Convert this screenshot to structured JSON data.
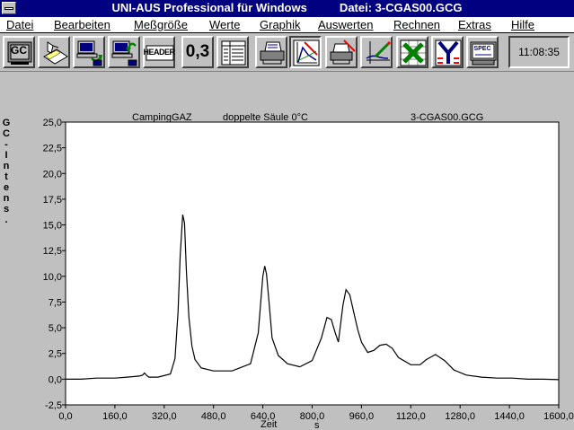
{
  "window": {
    "title": "UNI-AUS Professional für Windows          Datei: 3-CGAS00.GCG"
  },
  "menu": [
    {
      "label": "Datei"
    },
    {
      "label": "Bearbeiten"
    },
    {
      "label": "Meßgröße"
    },
    {
      "label": "Werte"
    },
    {
      "label": "Graphik"
    },
    {
      "label": "Auswerten"
    },
    {
      "label": "Rechnen"
    },
    {
      "label": "Extras"
    },
    {
      "label": "Hilfe"
    }
  ],
  "toolbar": {
    "gc_label": "GC",
    "header_label": "HEADER",
    "number_label": "0,3",
    "spec_label": "SPEC",
    "clock": "11:08:35",
    "icons": [
      "gc-icon",
      "hand-notepad-icon",
      "computer-download-icon",
      "computer-upload-icon",
      "header-icon",
      "value-icon",
      "table-icon",
      "printer-icon",
      "graph-icon",
      "printer-settings-icon",
      "pen-curve-icon",
      "excel-icon",
      "y-axis-icon",
      "spec-monitor-icon"
    ]
  },
  "colors": {
    "title_bar": "#000080",
    "plot_bg": "#ffffff",
    "trace": "#000000",
    "window_bg": "#c0c0c0"
  },
  "chart_data": {
    "type": "line",
    "header": {
      "left": "CampingGAZ",
      "middle": "doppelte Säule 0°C",
      "right": "3-CGAS00.GCG"
    },
    "ylabel": "GC-Intens.",
    "xlabel": "Zeit",
    "xunit": "s",
    "xlim": [
      0,
      1600
    ],
    "ylim": [
      -2.5,
      25
    ],
    "xticks": [
      0,
      160,
      320,
      480,
      640,
      800,
      960,
      1120,
      1280,
      1440,
      1600
    ],
    "xtick_labels": [
      "0,0",
      "160,0",
      "320,0",
      "480,0",
      "640,0",
      "800,0",
      "960,0",
      "1120,0",
      "1280,0",
      "1440,0",
      "1600,0"
    ],
    "yticks": [
      -2.5,
      0,
      2.5,
      5,
      7.5,
      10,
      12.5,
      15,
      17.5,
      20,
      22.5,
      25
    ],
    "ytick_labels": [
      "-2,5",
      "0,0",
      "2,5",
      "5,0",
      "7,5",
      "10,0",
      "12,5",
      "15,0",
      "17,5",
      "20,0",
      "22,5",
      "25,0"
    ],
    "grid": false,
    "series": [
      {
        "x": [
          0,
          50,
          100,
          160,
          200,
          240,
          250,
          256,
          262,
          270,
          300,
          340,
          355,
          365,
          372,
          380,
          386,
          392,
          400,
          410,
          420,
          440,
          480,
          540,
          600,
          625,
          640,
          646,
          652,
          660,
          670,
          690,
          720,
          760,
          800,
          830,
          848,
          862,
          875,
          885,
          900,
          910,
          922,
          935,
          948,
          960,
          980,
          1000,
          1020,
          1040,
          1060,
          1080,
          1120,
          1150,
          1170,
          1200,
          1230,
          1260,
          1300,
          1350,
          1400,
          1450,
          1500,
          1550,
          1600
        ],
        "y": [
          0.0,
          0.0,
          0.1,
          0.1,
          0.2,
          0.3,
          0.4,
          0.6,
          0.4,
          0.2,
          0.2,
          0.5,
          2.0,
          6.5,
          12.0,
          16.0,
          15.2,
          10.5,
          6.0,
          3.2,
          1.9,
          1.1,
          0.8,
          0.8,
          1.5,
          4.5,
          10.0,
          11.0,
          10.2,
          7.5,
          4.0,
          2.3,
          1.5,
          1.2,
          1.8,
          4.0,
          6.0,
          5.8,
          4.5,
          3.6,
          7.2,
          8.7,
          8.2,
          6.5,
          4.8,
          3.6,
          2.6,
          2.8,
          3.3,
          3.4,
          3.0,
          2.1,
          1.4,
          1.4,
          1.9,
          2.4,
          1.8,
          0.9,
          0.4,
          0.2,
          0.1,
          0.1,
          0.0,
          0.0,
          -0.05
        ]
      }
    ]
  }
}
